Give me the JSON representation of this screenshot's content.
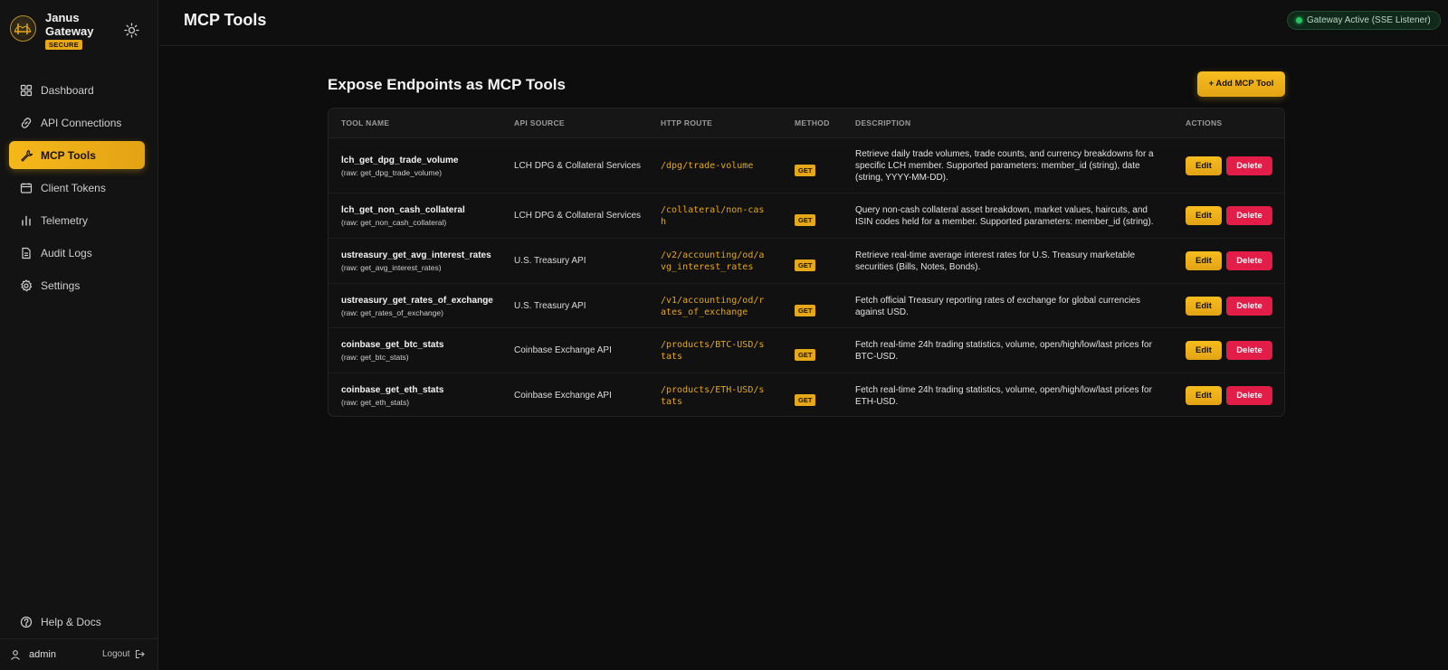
{
  "brand": {
    "name": "Janus Gateway",
    "badge": "SECURE"
  },
  "sidebar": {
    "items": [
      {
        "label": "Dashboard",
        "icon": "dashboard-icon"
      },
      {
        "label": "API Connections",
        "icon": "link-icon"
      },
      {
        "label": "MCP Tools",
        "icon": "wrench-icon",
        "active": true
      },
      {
        "label": "Client Tokens",
        "icon": "wallet-icon"
      },
      {
        "label": "Telemetry",
        "icon": "bar-chart-icon"
      },
      {
        "label": "Audit Logs",
        "icon": "document-icon"
      },
      {
        "label": "Settings",
        "icon": "gear-icon"
      }
    ],
    "help_label": "Help & Docs",
    "user": "admin",
    "logout_label": "Logout"
  },
  "header": {
    "title": "MCP Tools",
    "status": "Gateway Active (SSE Listener)"
  },
  "main": {
    "section_title": "Expose Endpoints as MCP Tools",
    "add_button": "+ Add MCP Tool",
    "columns": [
      "TOOL NAME",
      "API SOURCE",
      "HTTP ROUTE",
      "METHOD",
      "DESCRIPTION",
      "ACTIONS"
    ],
    "rows": [
      {
        "name": "lch_get_dpg_trade_volume",
        "raw": "(raw: get_dpg_trade_volume)",
        "source": "LCH DPG & Collateral Services",
        "route": "/dpg/trade-volume",
        "method": "GET",
        "description": "Retrieve daily trade volumes, trade counts, and currency breakdowns for a specific LCH member. Supported parameters: member_id (string), date (string, YYYY-MM-DD)."
      },
      {
        "name": "lch_get_non_cash_collateral",
        "raw": "(raw: get_non_cash_collateral)",
        "source": "LCH DPG & Collateral Services",
        "route": "/collateral/non-cash",
        "method": "GET",
        "description": "Query non-cash collateral asset breakdown, market values, haircuts, and ISIN codes held for a member. Supported parameters: member_id (string)."
      },
      {
        "name": "ustreasury_get_avg_interest_rates",
        "raw": "(raw: get_avg_interest_rates)",
        "source": "U.S. Treasury API",
        "route": "/v2/accounting/od/avg_interest_rates",
        "method": "GET",
        "description": "Retrieve real-time average interest rates for U.S. Treasury marketable securities (Bills, Notes, Bonds)."
      },
      {
        "name": "ustreasury_get_rates_of_exchange",
        "raw": "(raw: get_rates_of_exchange)",
        "source": "U.S. Treasury API",
        "route": "/v1/accounting/od/rates_of_exchange",
        "method": "GET",
        "description": "Fetch official Treasury reporting rates of exchange for global currencies against USD."
      },
      {
        "name": "coinbase_get_btc_stats",
        "raw": "(raw: get_btc_stats)",
        "source": "Coinbase Exchange API",
        "route": "/products/BTC-USD/stats",
        "method": "GET",
        "description": "Fetch real-time 24h trading statistics, volume, open/high/low/last prices for BTC-USD."
      },
      {
        "name": "coinbase_get_eth_stats",
        "raw": "(raw: get_eth_stats)",
        "source": "Coinbase Exchange API",
        "route": "/products/ETH-USD/stats",
        "method": "GET",
        "description": "Fetch real-time 24h trading statistics, volume, open/high/low/last prices for ETH-USD."
      }
    ],
    "edit_label": "Edit",
    "delete_label": "Delete"
  },
  "colors": {
    "accent": "#e6a817",
    "danger": "#e11d48",
    "status_ok": "#22c55e"
  }
}
